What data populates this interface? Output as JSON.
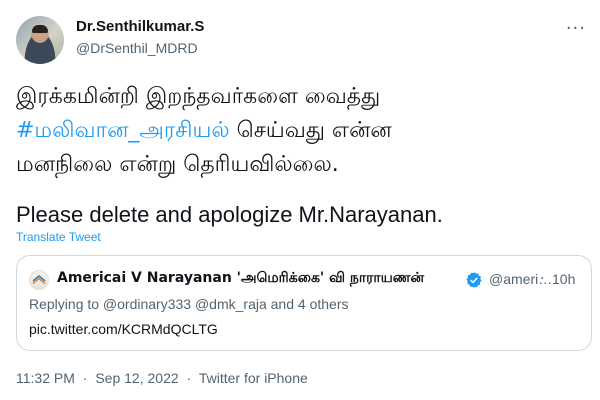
{
  "author": {
    "name": "Dr.Senthilkumar.S",
    "handle": "@DrSenthil_MDRD"
  },
  "more_icon": "more-horizontal-icon",
  "tweet": {
    "line1": "இரக்கமின்றி இறந்தவர்களை வைத்து",
    "hashtag": "#மலிவான_அரசியல்",
    "line2_rest": " செய்வது என்ன",
    "line3": "மனநிலை என்று தெரியவில்லை.",
    "english": "Please delete and apologize Mr.Narayanan."
  },
  "translate_label": "Translate Tweet",
  "quoted": {
    "name": "Americai V Narayanan 'அமெரிக்கை' வி நாராயணன்",
    "verified_icon": "verified-badge-icon",
    "handle": "@ameri…",
    "dot": "·",
    "time": "10h",
    "replying": "Replying to @ordinary333 @dmk_raja and 4 others",
    "link": "pic.twitter.com/KCRMdQCLTG"
  },
  "meta": {
    "time": "11:32 PM",
    "sep1": "·",
    "date": "Sep 12, 2022",
    "sep2": "·",
    "source": "Twitter for iPhone"
  },
  "colors": {
    "link_blue": "#1d9bf0",
    "secondary_text": "#536471",
    "border": "#cfd9de"
  }
}
